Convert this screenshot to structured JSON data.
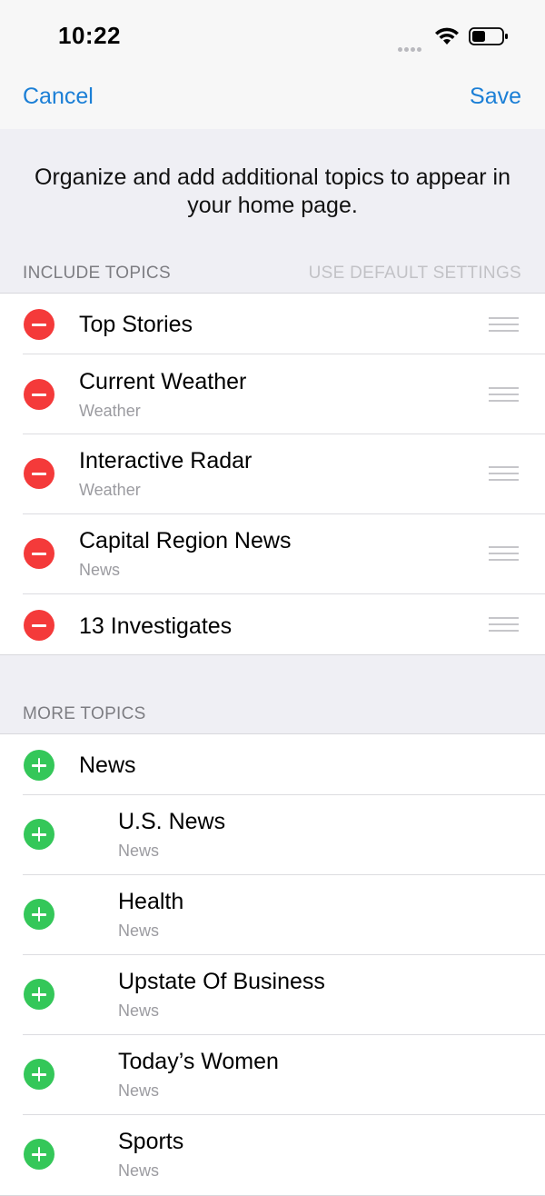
{
  "status_bar": {
    "time": "10:22"
  },
  "nav": {
    "cancel_label": "Cancel",
    "save_label": "Save"
  },
  "intro": {
    "text": "Organize and add additional topics to appear in your home page."
  },
  "include_section": {
    "header": "INCLUDE TOPICS",
    "action_label": "USE DEFAULT SETTINGS",
    "items": [
      {
        "title": "Top Stories",
        "subtitle": ""
      },
      {
        "title": "Current Weather",
        "subtitle": "Weather"
      },
      {
        "title": "Interactive Radar",
        "subtitle": "Weather"
      },
      {
        "title": "Capital Region News",
        "subtitle": "News"
      },
      {
        "title": "13 Investigates",
        "subtitle": ""
      }
    ]
  },
  "more_section": {
    "header": "MORE TOPICS",
    "items": [
      {
        "title": "News",
        "subtitle": ""
      },
      {
        "title": "U.S. News",
        "subtitle": "News"
      },
      {
        "title": "Health",
        "subtitle": "News"
      },
      {
        "title": "Upstate Of Business",
        "subtitle": "News"
      },
      {
        "title": "Today’s Women",
        "subtitle": "News"
      },
      {
        "title": "Sports",
        "subtitle": "News"
      }
    ]
  },
  "colors": {
    "accent": "#1b7fd6",
    "remove": "#f43a3a",
    "add": "#34c759",
    "background": "#efeff4"
  },
  "icons": {
    "remove": "minus-circle-icon",
    "add": "plus-circle-icon",
    "reorder": "drag-handle-icon",
    "wifi": "wifi-icon",
    "battery": "battery-icon",
    "signal": "signal-icon"
  }
}
